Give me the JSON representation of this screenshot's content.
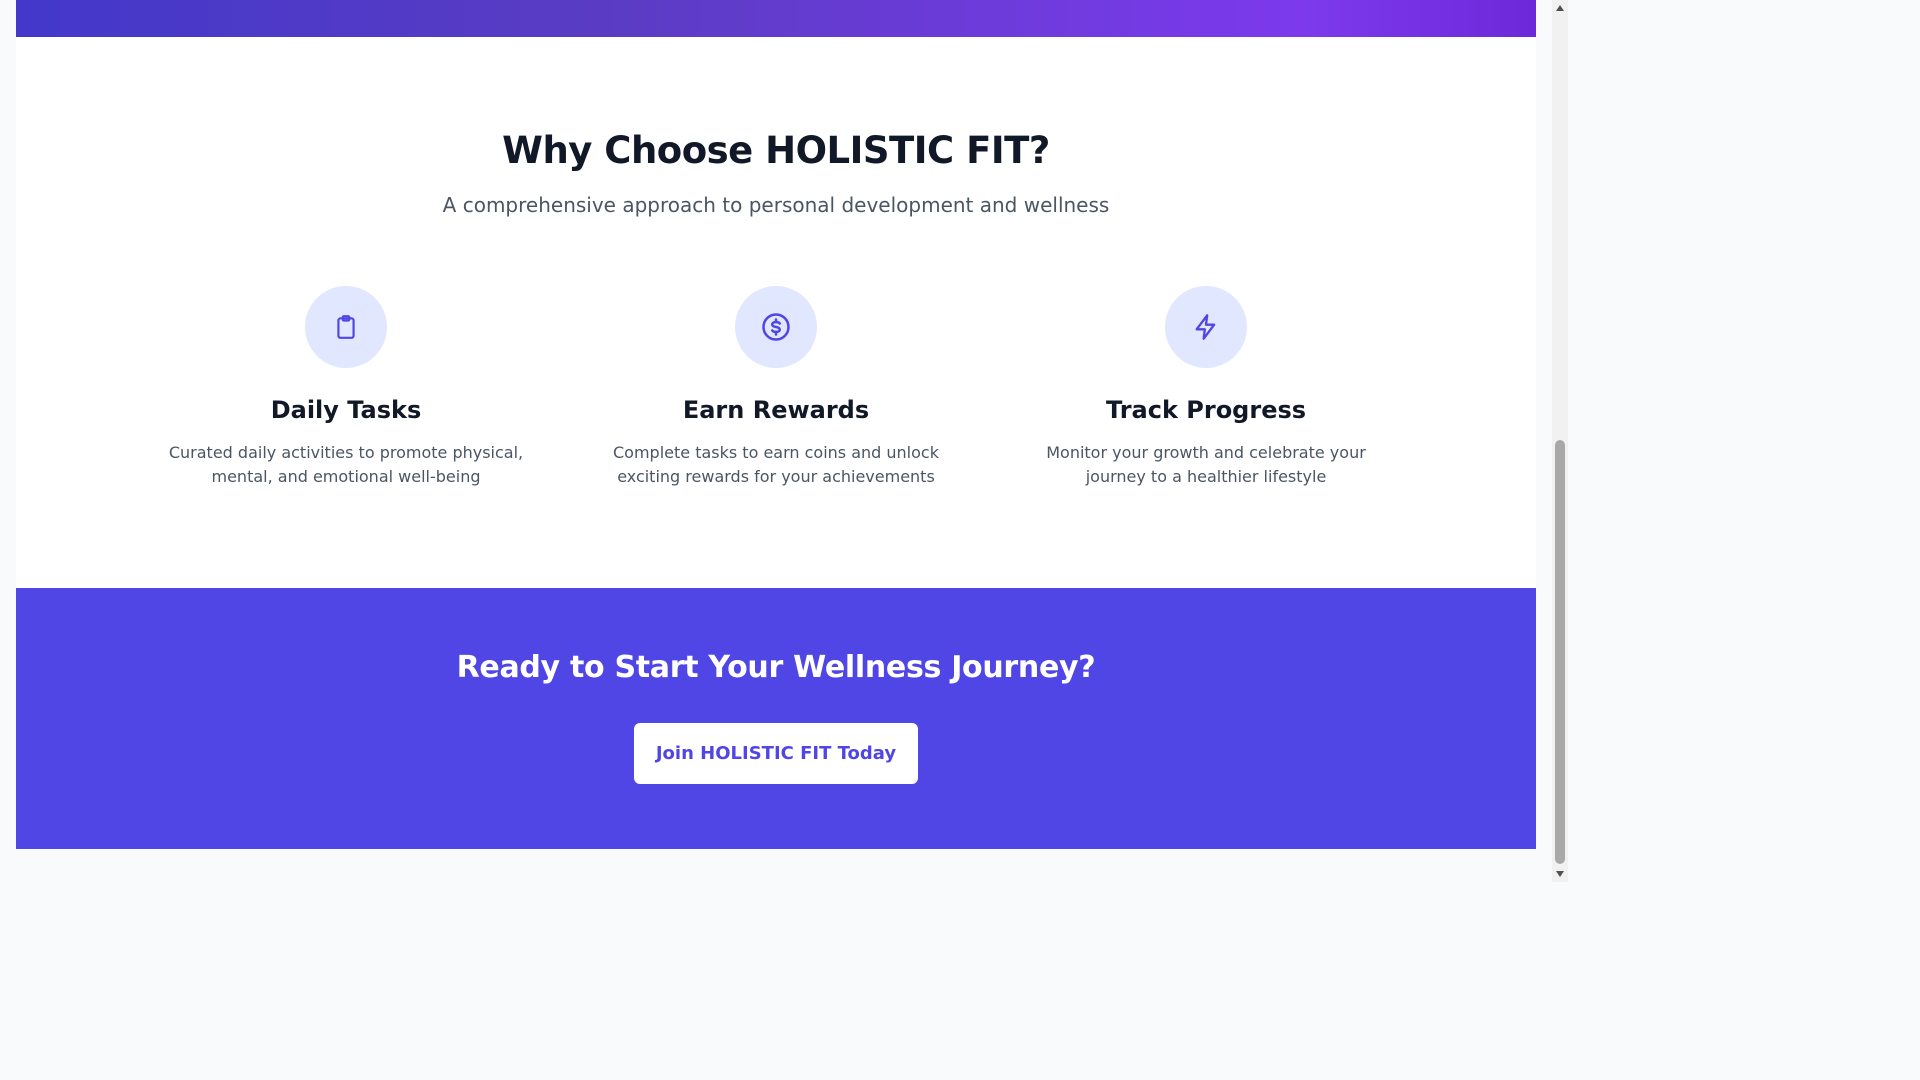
{
  "features": {
    "title": "Why Choose HOLISTIC FIT?",
    "subtitle": "A comprehensive approach to personal development and wellness",
    "cards": [
      {
        "icon": "clipboard-icon",
        "title": "Daily Tasks",
        "description": "Curated daily activities to promote physical, mental, and emotional well-being"
      },
      {
        "icon": "dollar-coin-icon",
        "title": "Earn Rewards",
        "description": "Complete tasks to earn coins and unlock exciting rewards for your achievements"
      },
      {
        "icon": "lightning-icon",
        "title": "Track Progress",
        "description": "Monitor your growth and celebrate your journey to a healthier lifestyle"
      }
    ]
  },
  "cta": {
    "title": "Ready to Start Your Wellness Journey?",
    "button_label": "Join HOLISTIC FIT Today"
  },
  "colors": {
    "accent": "#4f46e5",
    "icon_bg": "#e0e7ff",
    "heading": "#111827",
    "body_text": "#4b5563"
  }
}
